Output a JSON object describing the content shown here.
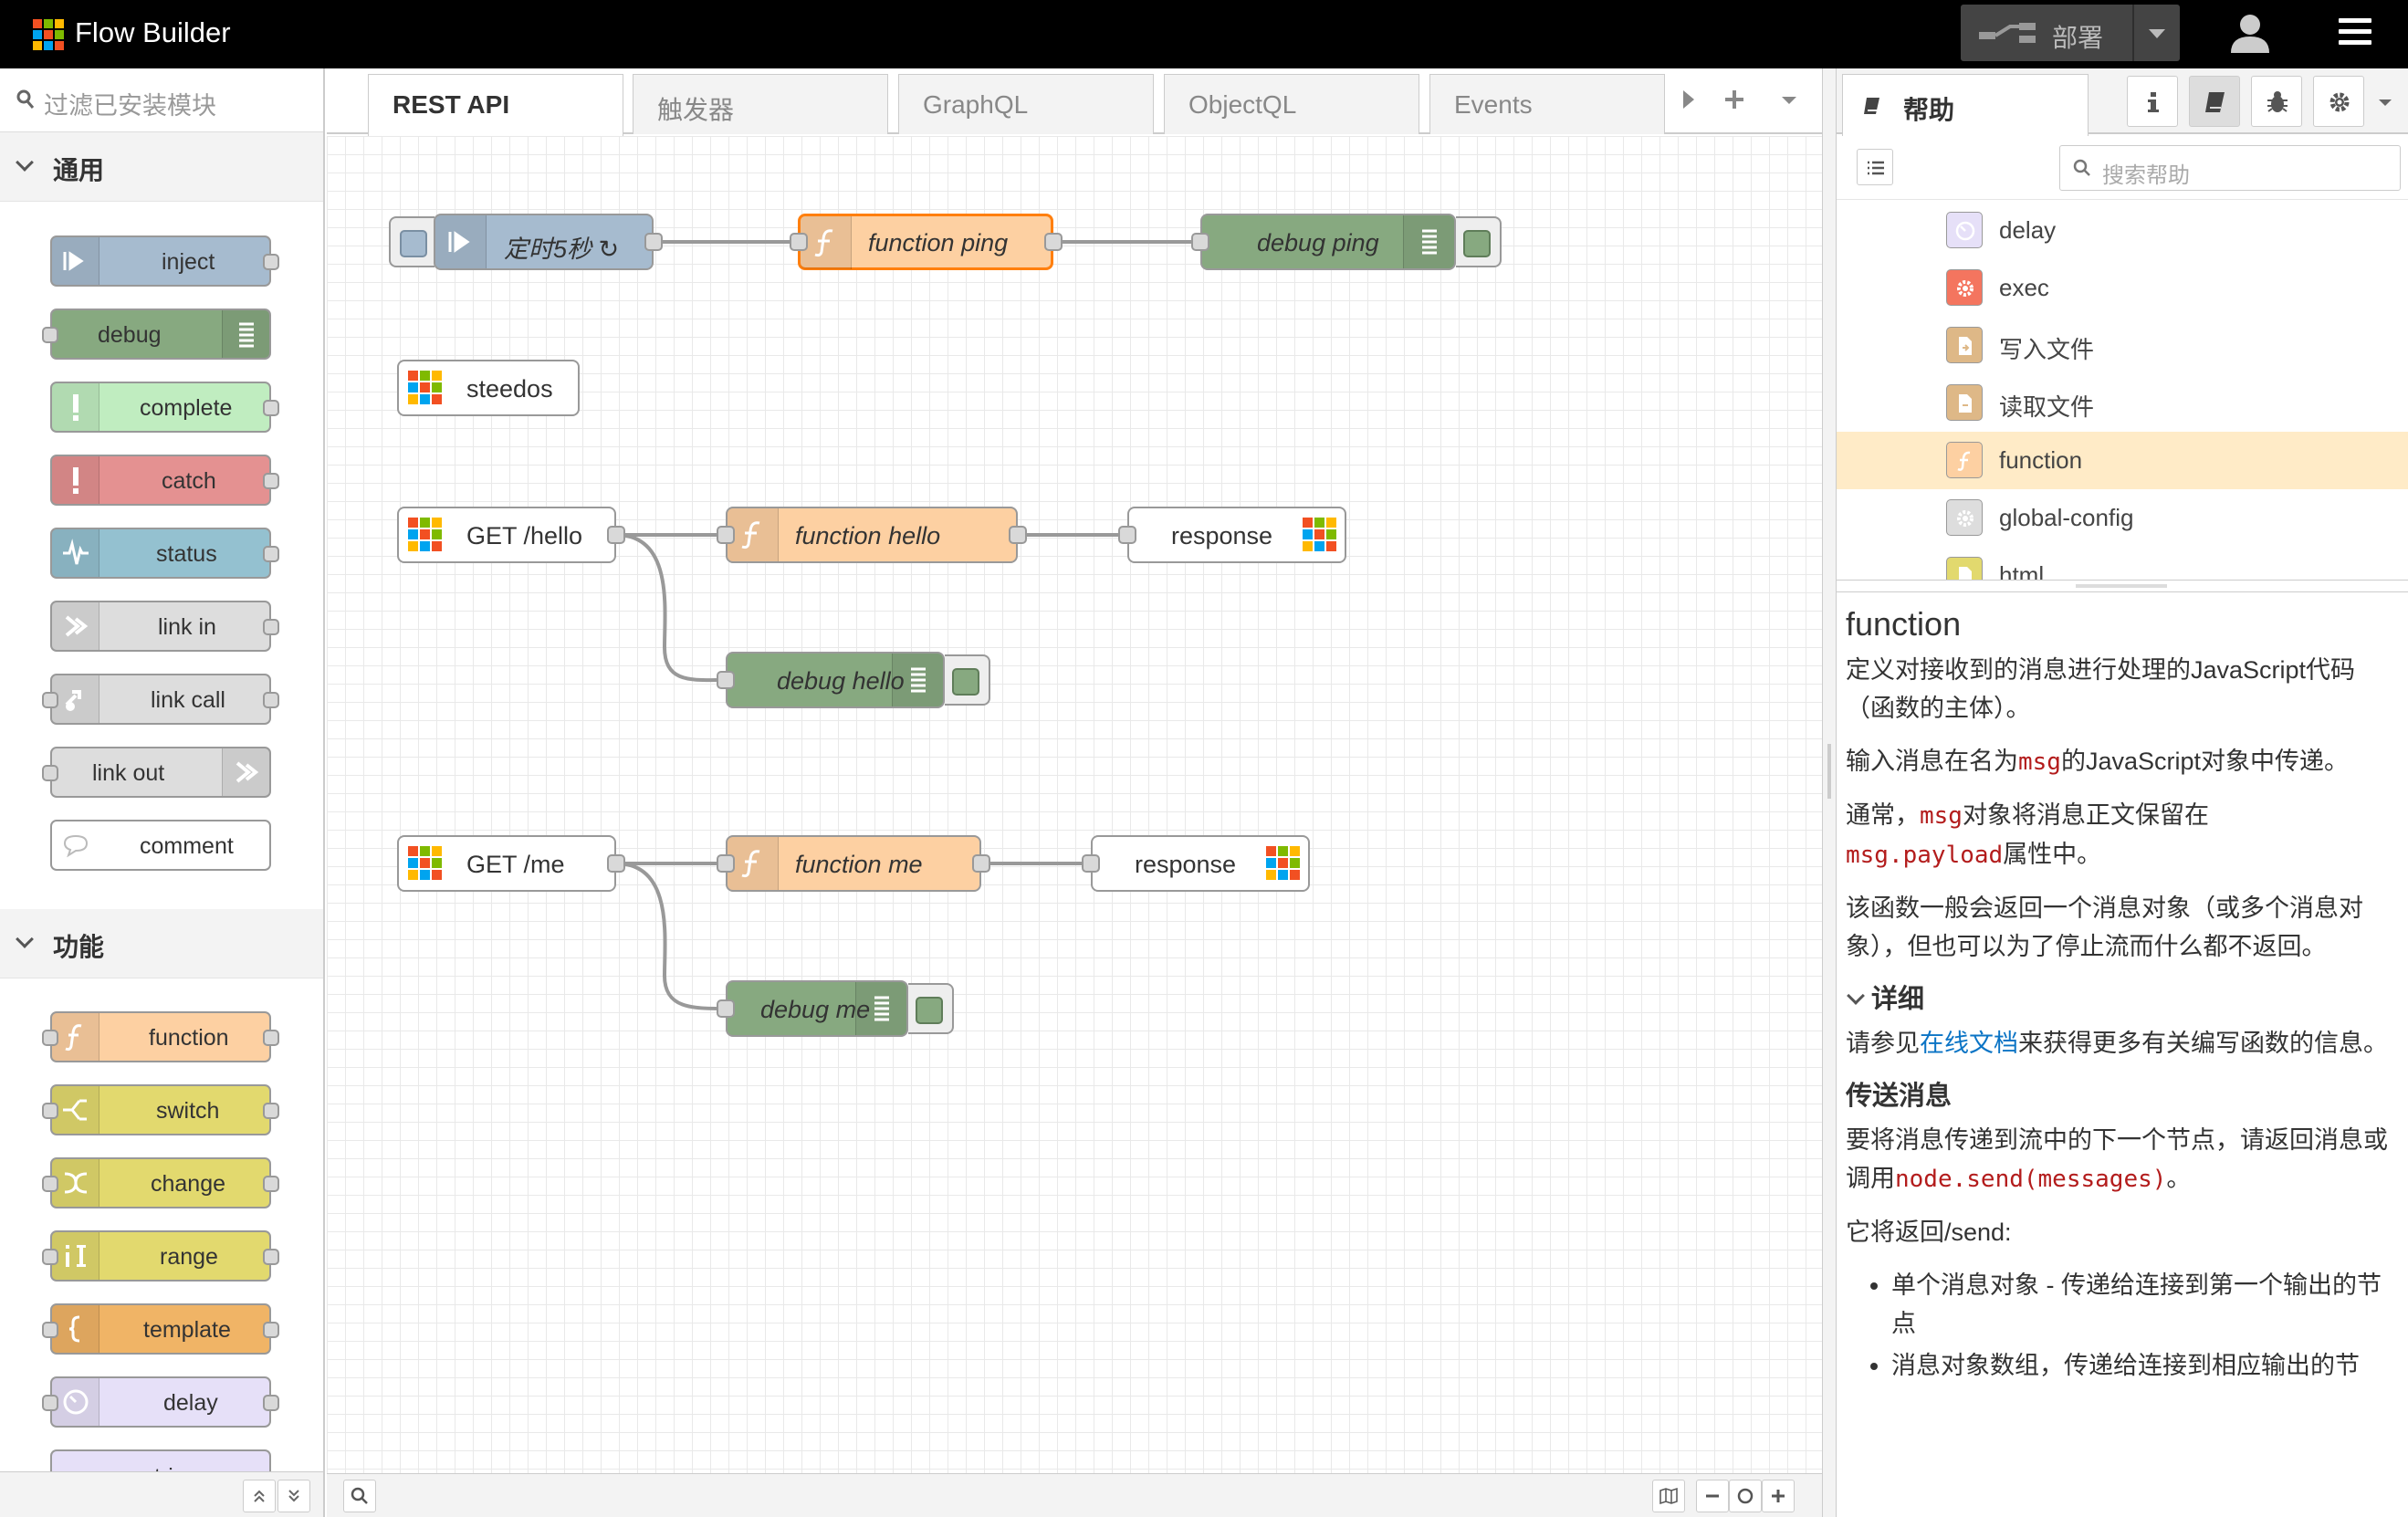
{
  "app": {
    "title": "Flow Builder"
  },
  "header": {
    "deploy_label": "部署"
  },
  "palette": {
    "filter_placeholder": "过滤已安装模块",
    "categories": [
      {
        "label": "通用",
        "nodes": [
          "inject",
          "debug",
          "complete",
          "catch",
          "status",
          "link in",
          "link call",
          "link out",
          "comment"
        ]
      },
      {
        "label": "功能",
        "nodes": [
          "function",
          "switch",
          "change",
          "range",
          "template",
          "delay",
          "trigger"
        ]
      }
    ]
  },
  "tabs": [
    "REST API",
    "触发器",
    "GraphQL",
    "ObjectQL",
    "Events"
  ],
  "flow": {
    "nodes": {
      "inject": "定时5秒 ↻",
      "function_ping": "function ping",
      "debug_ping": "debug ping",
      "steedos": "steedos",
      "get_hello": "GET /hello",
      "function_hello": "function hello",
      "response_1": "response",
      "debug_hello": "debug hello",
      "get_me": "GET /me",
      "function_me": "function me",
      "response_2": "response",
      "debug_me": "debug me"
    }
  },
  "sidebar": {
    "active_tab": "帮助",
    "search_placeholder": "搜索帮助",
    "tree": [
      "delay",
      "exec",
      "写入文件",
      "读取文件",
      "function",
      "global-config",
      "html"
    ],
    "selected": "function",
    "help": {
      "title": "function",
      "p1": "定义对接收到的消息进行处理的JavaScript代码（函数的主体）。",
      "p2_a": "输入消息在名为",
      "p2_code": "msg",
      "p2_b": "的JavaScript对象中传递。",
      "p3_a": "通常，",
      "p3_code1": "msg",
      "p3_b": "对象将消息正文保留在",
      "p3_code2": "msg.payload",
      "p3_c": "属性中。",
      "p4": "该函数一般会返回一个消息对象（或多个消息对象），但也可以为了停止流而什么都不返回。",
      "details_heading": "详细",
      "p5_a": "请参见",
      "p5_link": "在线文档",
      "p5_b": "来获得更多有关编写函数的信息。",
      "send_heading": "传送消息",
      "p6_a": "要将消息传递到流中的下一个节点，请返回消息或调用",
      "p6_code": "node.send(messages)",
      "p6_b": "。",
      "p7": "它将返回/send:",
      "li1": "单个消息对象 - 传递给连接到第一个输出的节点",
      "li2": "消息对象数组，传递给连接到相应输出的节"
    }
  },
  "colors": {
    "inject": "#a6bbcf",
    "debug": "#87a980",
    "complete": "#c0edc0",
    "catch": "#e49191",
    "status": "#94c1d0",
    "link": "#dddddd",
    "comment": "#ffffff",
    "function": "#fdd0a2",
    "switch": "#e2d96e",
    "template": "#f0b466",
    "delay": "#e6e0f8",
    "selected_border": "#ff7f0e"
  }
}
